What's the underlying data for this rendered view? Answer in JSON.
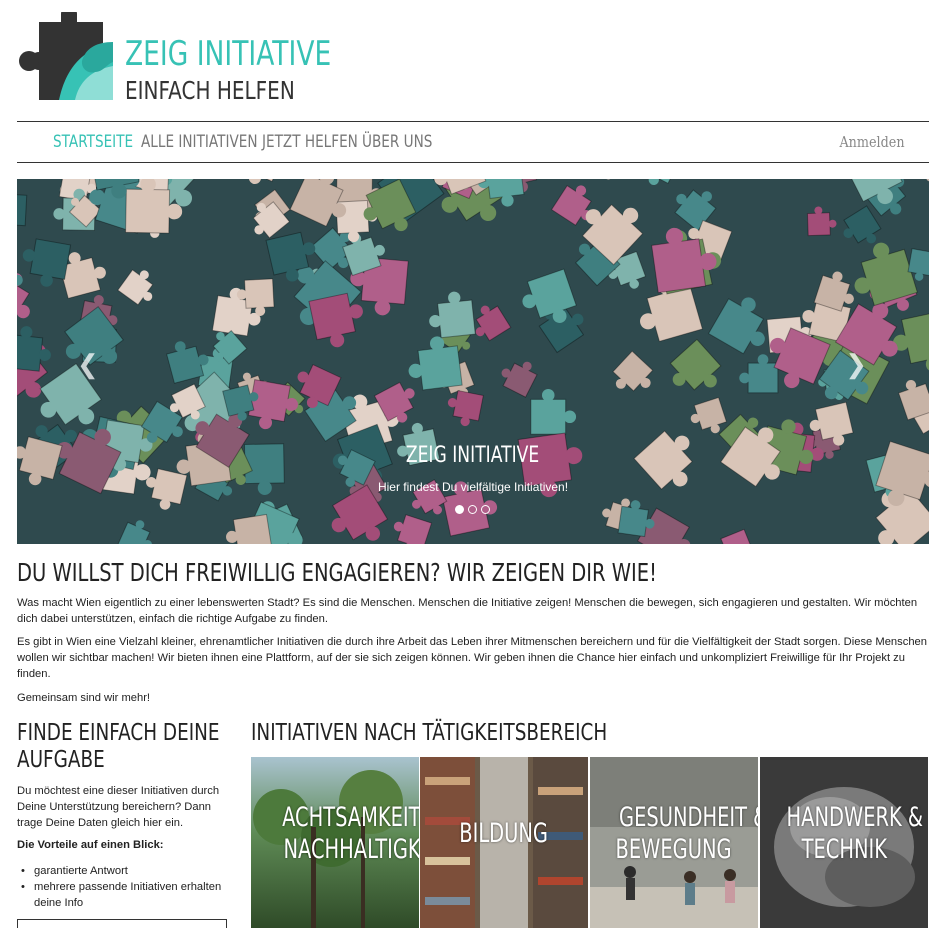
{
  "brand": {
    "title": "ZEIG INITIATIVE",
    "subtitle": "EINFACH HELFEN",
    "colors": {
      "accent": "#37c2b5",
      "dark": "#333333"
    },
    "icon": "puzzle-logo-icon"
  },
  "nav": {
    "items": [
      {
        "label": "STARTSEITE",
        "active": true
      },
      {
        "label": "ALLE INITIATIVEN",
        "active": false
      },
      {
        "label": "JETZT HELFEN",
        "active": false
      },
      {
        "label": "ÜBER UNS",
        "active": false
      }
    ],
    "login": "Anmelden"
  },
  "carousel": {
    "title": "ZEIG INITIATIVE",
    "subtitle": "Hier findest Du vielfältige Initiativen!",
    "prev_icon": "chevron-left-icon",
    "next_icon": "chevron-right-icon",
    "slides": 3,
    "active_slide": 1
  },
  "intro": {
    "heading": "DU WILLST DICH FREIWILLIG ENGAGIEREN? WIR ZEIGEN DIR WIE!",
    "p1": "Was macht Wien eigentlich zu einer lebenswerten Stadt? Es sind die Menschen. Menschen die Initiative zeigen! Menschen die bewegen, sich engagieren und gestalten. Wir möchten dich dabei unterstützen, einfach die richtige Aufgabe zu finden.",
    "p2": "Es gibt in Wien eine Vielzahl kleiner, ehrenamtlicher Initiativen die durch ihre Arbeit das Leben ihrer Mitmenschen bereichern und für die Vielfältigkeit der Stadt sorgen. Diese Menschen wollen wir sichtbar machen! Wir bieten ihnen eine Plattform, auf der sie sich zeigen können. Wir geben ihnen die Chance hier einfach und unkompliziert Freiwillige für Ihr Projekt zu finden.",
    "p3": "Gemeinsam sind wir mehr!"
  },
  "task": {
    "heading": "FINDE EINFACH DEINE AUFGABE",
    "text": "Du möchtest eine dieser Initiativen durch Deine Unterstützung bereichern? Dann trage Deine Daten gleich hier ein.",
    "benefits_title": "Die Vorteile auf einen Blick:",
    "benefits": [
      "garantierte Antwort",
      "mehrere passende Initiativen erhalten deine Info"
    ]
  },
  "categories": {
    "heading": "INITIATIVEN NACH TÄTIGKEITSBEREICH",
    "tiles": [
      {
        "line1": "ACHTSAMKEIT &",
        "line2": "NACHHALTIGKEIT"
      },
      {
        "line1": "BILDUNG",
        "line2": ""
      },
      {
        "line1": "GESUNDHEIT &",
        "line2": "BEWEGUNG"
      },
      {
        "line1": "HANDWERK &",
        "line2": "TECHNIK"
      }
    ]
  }
}
